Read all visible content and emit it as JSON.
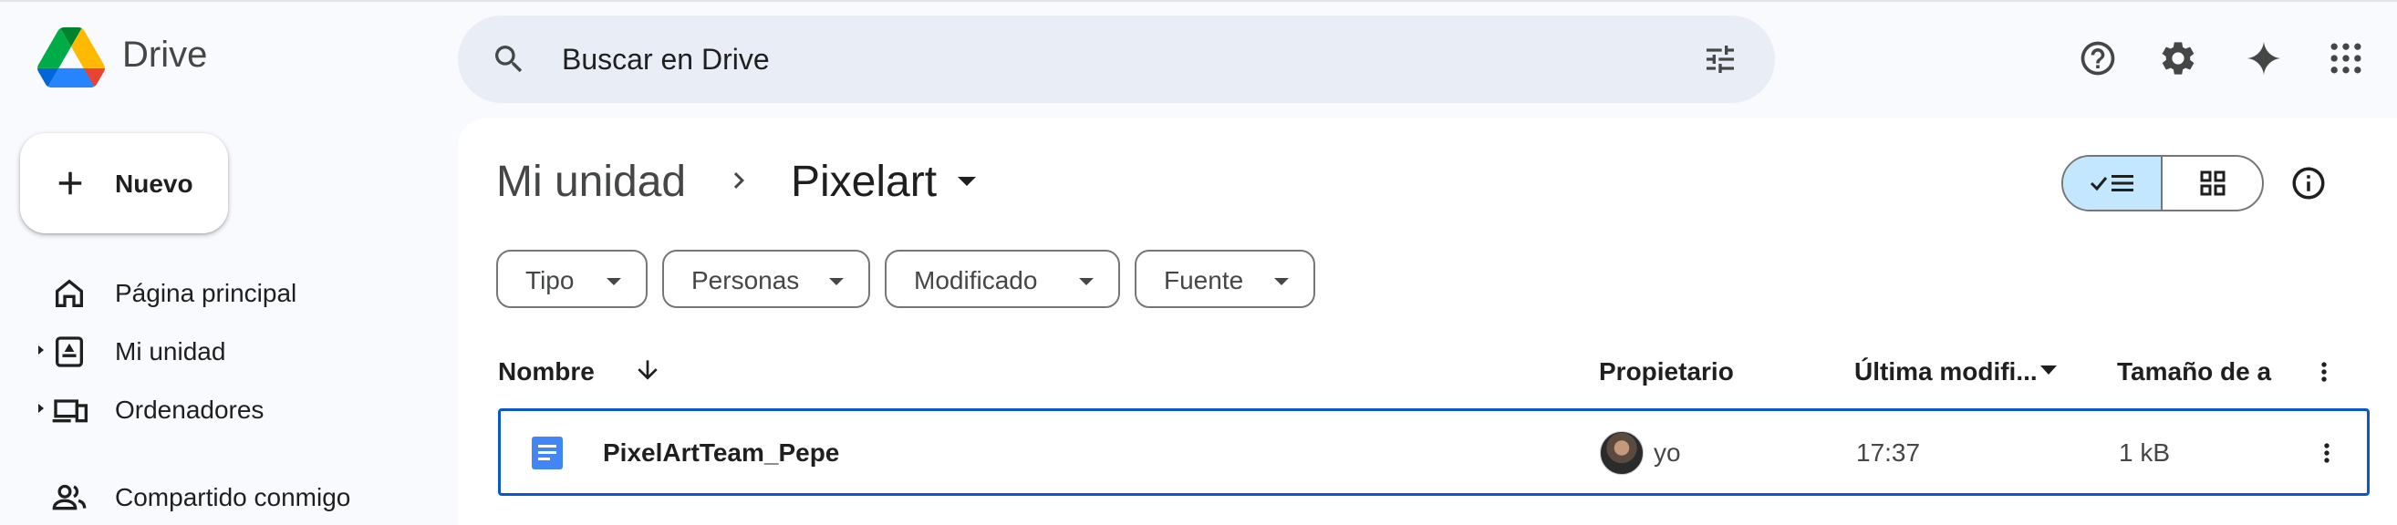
{
  "header": {
    "brand": "Drive",
    "search_placeholder": "Buscar en Drive",
    "icons": [
      "search-icon",
      "tune-icon",
      "help-icon",
      "settings-icon",
      "gemini-icon",
      "apps-grid-icon"
    ]
  },
  "sidebar": {
    "new_button": "Nuevo",
    "items": [
      {
        "label": "Página principal",
        "icon": "home-icon"
      },
      {
        "label": "Mi unidad",
        "icon": "my-drive-icon"
      },
      {
        "label": "Ordenadores",
        "icon": "computers-icon"
      },
      {
        "label": "Compartido conmigo",
        "icon": "shared-icon"
      }
    ]
  },
  "breadcrumb": {
    "root": "Mi unidad",
    "current": "Pixelart"
  },
  "filters": [
    "Tipo",
    "Personas",
    "Modificado",
    "Fuente"
  ],
  "table": {
    "columns": {
      "name": "Nombre",
      "owner": "Propietario",
      "modified": "Última modifi...",
      "size": "Tamaño de a"
    },
    "rows": [
      {
        "name": "PixelArtTeam_Pepe",
        "owner": "yo",
        "modified": "17:37",
        "size": "1 kB",
        "icon": "google-docs-icon"
      }
    ]
  },
  "colors": {
    "accent": "#0b57d0",
    "search_bg": "#e9eef6",
    "page_bg": "#f8fafd",
    "toggle_active": "#c2e7ff",
    "docs_blue": "#4285f4"
  }
}
